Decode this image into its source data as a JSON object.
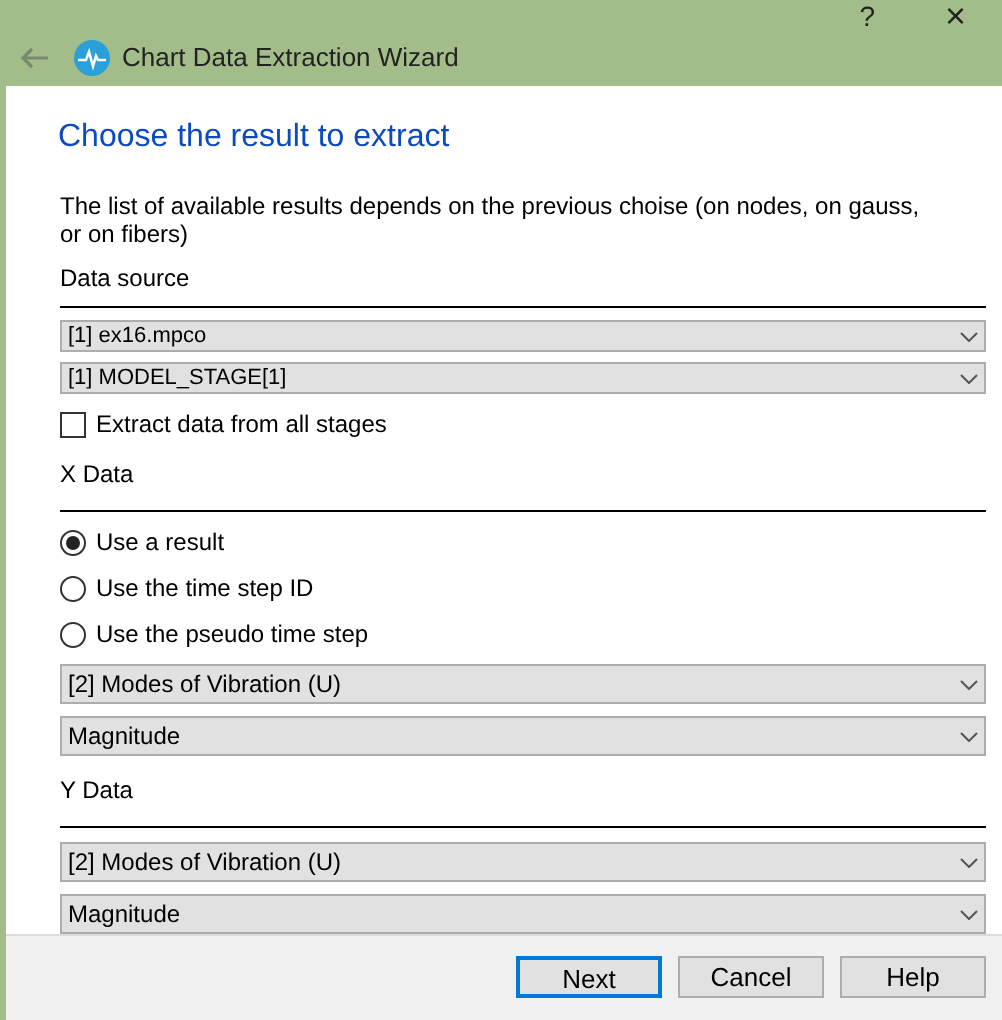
{
  "window": {
    "title": "Chart Data Extraction Wizard",
    "help": "?",
    "close": "×"
  },
  "heading": "Choose the result to extract",
  "description": "The list of available results depends on the previous choise (on nodes, on gauss, or on fibers)",
  "data_source": {
    "label": "Data source",
    "combos": [
      {
        "value": "[1] ex16.mpco"
      },
      {
        "value": "[1] MODEL_STAGE[1]"
      }
    ],
    "checkbox": {
      "label": "Extract data from all stages",
      "checked": false
    }
  },
  "x_data": {
    "label": "X Data",
    "radios": [
      {
        "label": "Use a result",
        "selected": true
      },
      {
        "label": "Use the time step ID",
        "selected": false
      },
      {
        "label": "Use the pseudo time step",
        "selected": false
      }
    ],
    "combos": [
      {
        "value": "[2] Modes of Vibration (U)"
      },
      {
        "value": "Magnitude"
      }
    ]
  },
  "y_data": {
    "label": "Y Data",
    "combos": [
      {
        "value": "[2] Modes of Vibration (U)"
      },
      {
        "value": "Magnitude"
      }
    ]
  },
  "buttons": [
    {
      "label": "Next",
      "default": true
    },
    {
      "label": "Cancel",
      "default": false
    },
    {
      "label": "Help",
      "default": false
    }
  ]
}
